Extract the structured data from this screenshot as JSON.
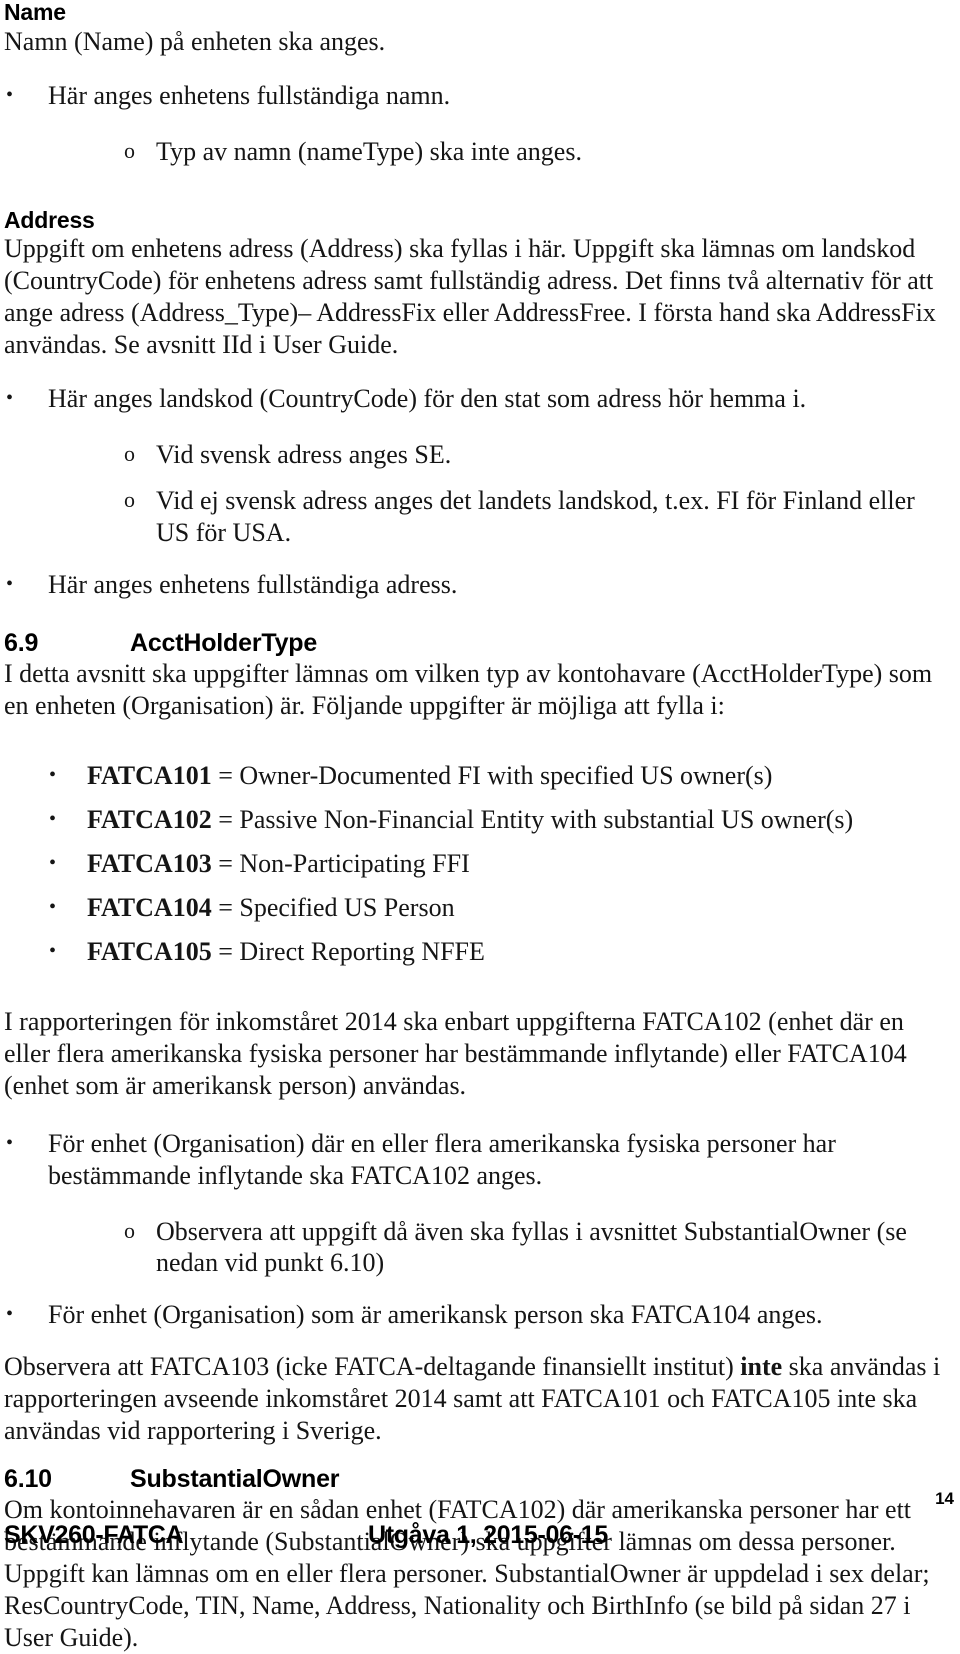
{
  "document": {
    "footer_left": "SKV260-FATCA",
    "footer_center": "Utgåva 1,  2015-06-15",
    "page_number": "14"
  },
  "sections": {
    "name": {
      "heading": "Name",
      "intro": "Namn (Name) på enheten ska anges.",
      "bullets": [
        {
          "marker": "•",
          "text": "Här anges enhetens fullständiga namn."
        }
      ],
      "subbullets": [
        {
          "marker": "o",
          "text": "Typ av namn (nameType) ska inte anges."
        }
      ]
    },
    "address": {
      "heading": "Address",
      "intro": "Uppgift om enhetens adress (Address) ska fyllas i här. Uppgift ska lämnas om landskod (CountryCode) för enhetens adress samt fullständig adress. Det finns två alternativ för att ange adress (Address_Type)– AddressFix eller AddressFree. I första hand ska AddressFix användas. Se avsnitt IId i User Guide.",
      "bullet_countrycode": {
        "marker": "•",
        "text": "Här anges landskod (CountryCode) för den stat som adress hör hemma i."
      },
      "subbullets": [
        {
          "marker": "o",
          "text": "Vid svensk adress anges SE."
        },
        {
          "marker": "o",
          "text": "Vid ej svensk adress anges det landets landskod, t.ex. FI för Finland eller US för USA."
        }
      ],
      "bullet_fulladdress": {
        "marker": "•",
        "text": "Här anges enhetens fullständiga adress."
      }
    },
    "accholdertype": {
      "number": "6.9",
      "title": "AcctHolderType",
      "intro": "I detta avsnitt ska uppgifter lämnas om vilken typ av kontohavare (AcctHolderType) som en enheten (Organisation) är. Följande uppgifter är möjliga att fylla i:",
      "codes": [
        {
          "marker": "•",
          "code": "FATCA101",
          "separator": " = ",
          "description": "Owner-Documented FI with specified US owner(s)"
        },
        {
          "marker": "•",
          "code": "FATCA102",
          "separator": " = ",
          "description": "Passive Non-Financial Entity with substantial US owner(s)"
        },
        {
          "marker": "•",
          "code": "FATCA103",
          "separator": " = ",
          "description": "Non-Participating FFI"
        },
        {
          "marker": "•",
          "code": "FATCA104",
          "separator": " = ",
          "description": "Specified US Person"
        },
        {
          "marker": "•",
          "code": "FATCA105",
          "separator": " = ",
          "description": "Direct Reporting NFFE"
        }
      ],
      "note_2014": "I rapporteringen för inkomståret 2014 ska enbart uppgifterna FATCA102 (enhet där en eller flera amerikanska fysiska personer har bestämmande inflytande) eller FATCA104 (enhet som är amerikansk person) användas.",
      "bullet_102": {
        "marker": "•",
        "text": "För enhet (Organisation) där en eller flera amerikanska fysiska personer har bestämmande inflytande ska FATCA102 anges."
      },
      "subbullet_102": {
        "marker": "o",
        "text": "Observera att uppgift då även ska fyllas i avsnittet SubstantialOwner (se nedan vid punkt 6.10)"
      },
      "bullet_104": {
        "marker": "•",
        "text": "För enhet (Organisation) som är amerikansk person ska FATCA104 anges."
      },
      "note_103_part1": "Observera att FATCA103 (icke FATCA-deltagande finansiellt institut) ",
      "note_103_bold": "inte",
      "note_103_part2": " ska användas i rapporteringen avseende inkomståret 2014 samt att FATCA101 och FATCA105 inte ska användas vid rapportering i Sverige."
    },
    "substantialowner": {
      "number": "6.10",
      "title": "SubstantialOwner",
      "intro": "Om kontoinnehavaren är en sådan enhet (FATCA102) där amerikanska personer har ett bestämmande inflytande (SubstantialOwner) ska uppgifter lämnas om dessa personer. Uppgift kan lämnas om en eller flera personer. SubstantialOwner är uppdelad i sex delar; ResCountryCode, TIN, Name, Address, Nationality och BirthInfo  (se bild på sidan 27 i User Guide)."
    }
  }
}
